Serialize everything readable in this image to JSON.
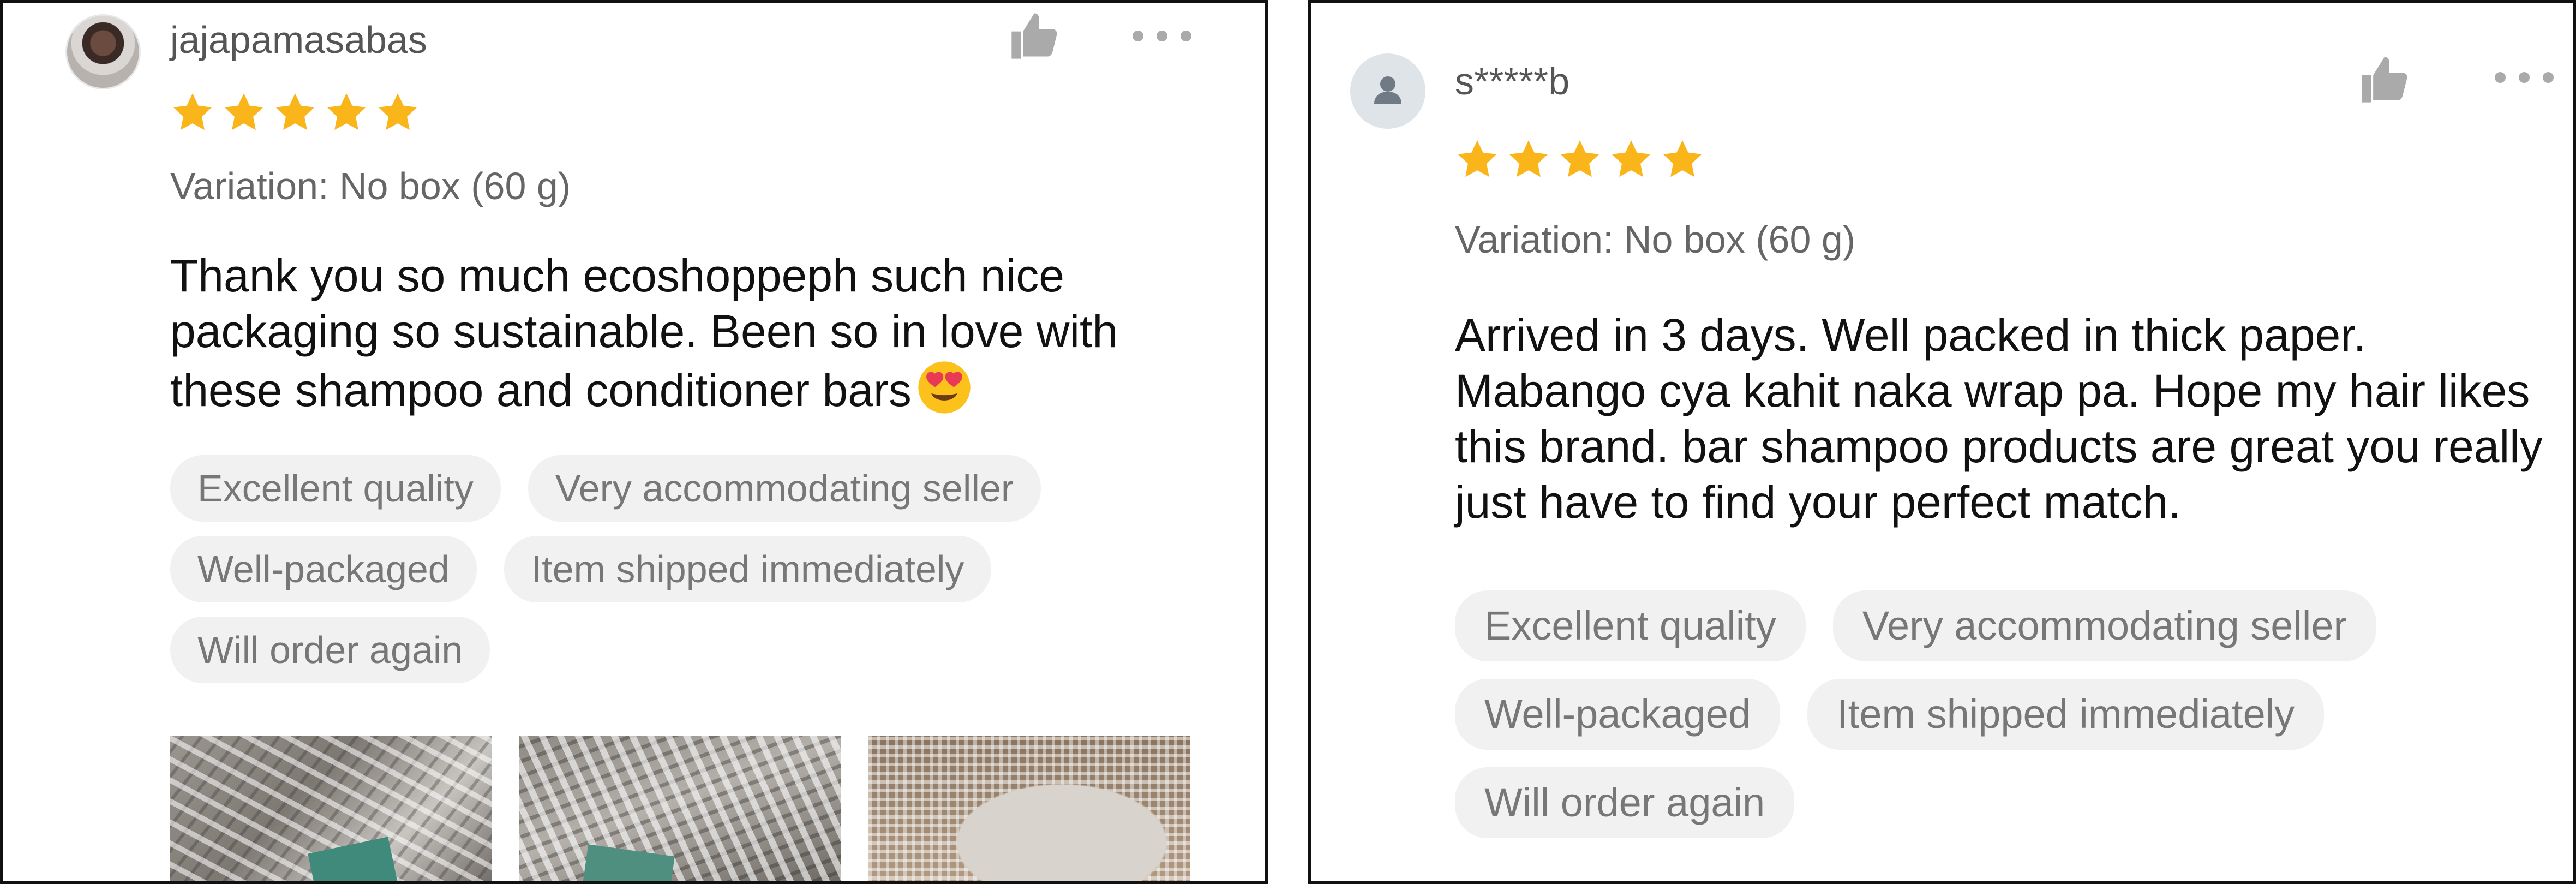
{
  "colors": {
    "star": "#f9b51a",
    "tag_bg": "#f1f1f1",
    "tag_text": "#777777",
    "icon_gray": "#aaaaaa",
    "review_text": "#111111"
  },
  "reviews": [
    {
      "username": "jajapamasabas",
      "avatar": "user-photo",
      "rating": 5,
      "variation": "Variation: No box (60 g)",
      "text": "Thank you so much ecoshoppeph such nice packaging so sustainable. Been so in love with these shampoo and conditioner bars",
      "emoji": "heart-eyes-emoji",
      "tags": [
        "Excellent quality",
        "Very accommodating seller",
        "Well-packaged",
        "Item shipped immediately",
        "Will order again"
      ],
      "icons": {
        "like": "thumbs-up-icon",
        "more": "more-options-icon"
      }
    },
    {
      "username": "s*****b",
      "avatar": "default-user-icon",
      "rating": 5,
      "variation": "Variation: No box (60 g)",
      "text": "Arrived in 3 days. Well packed in thick paper. Mabango cya kahit naka wrap pa. Hope my hair likes this brand. bar shampoo products are great you really just have to find your perfect match.",
      "tags": [
        "Excellent quality",
        "Very accommodating seller",
        "Well-packaged",
        "Item shipped immediately",
        "Will order again"
      ],
      "icons": {
        "like": "thumbs-up-icon",
        "more": "more-options-icon"
      }
    }
  ]
}
